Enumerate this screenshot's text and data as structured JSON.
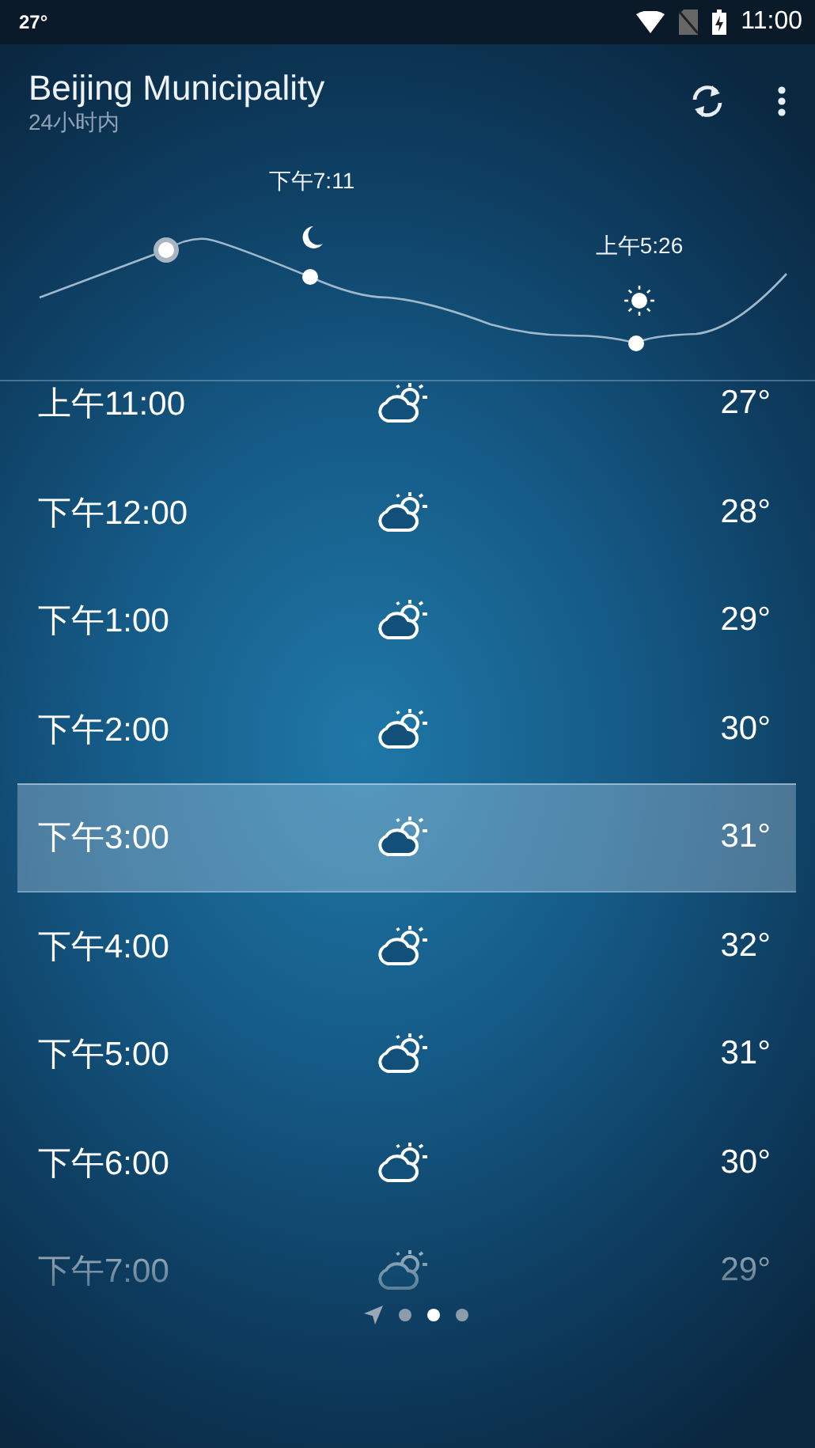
{
  "status_bar": {
    "left": "27°",
    "time": "11:00"
  },
  "app_bar": {
    "title": "Beijing Municipality",
    "subtitle": "24小时内"
  },
  "sun_chart": {
    "events": [
      {
        "kind": "moon",
        "label": "下午7:11"
      },
      {
        "kind": "sun",
        "label": "上午5:26"
      }
    ]
  },
  "hours": [
    {
      "time": "上午11:00",
      "temp": "27°",
      "selected": false
    },
    {
      "time": "下午12:00",
      "temp": "28°",
      "selected": false
    },
    {
      "time": "下午1:00",
      "temp": "29°",
      "selected": false
    },
    {
      "time": "下午2:00",
      "temp": "30°",
      "selected": false
    },
    {
      "time": "下午3:00",
      "temp": "31°",
      "selected": true
    },
    {
      "time": "下午4:00",
      "temp": "32°",
      "selected": false
    },
    {
      "time": "下午5:00",
      "temp": "31°",
      "selected": false
    },
    {
      "time": "下午6:00",
      "temp": "30°",
      "selected": false
    },
    {
      "time": "下午7:00",
      "temp": "29°",
      "selected": false
    }
  ],
  "pager": [
    {
      "kind": "location",
      "selected": false
    },
    {
      "kind": "dot",
      "selected": false
    },
    {
      "kind": "dot",
      "selected": true
    },
    {
      "kind": "dot",
      "selected": false
    }
  ]
}
